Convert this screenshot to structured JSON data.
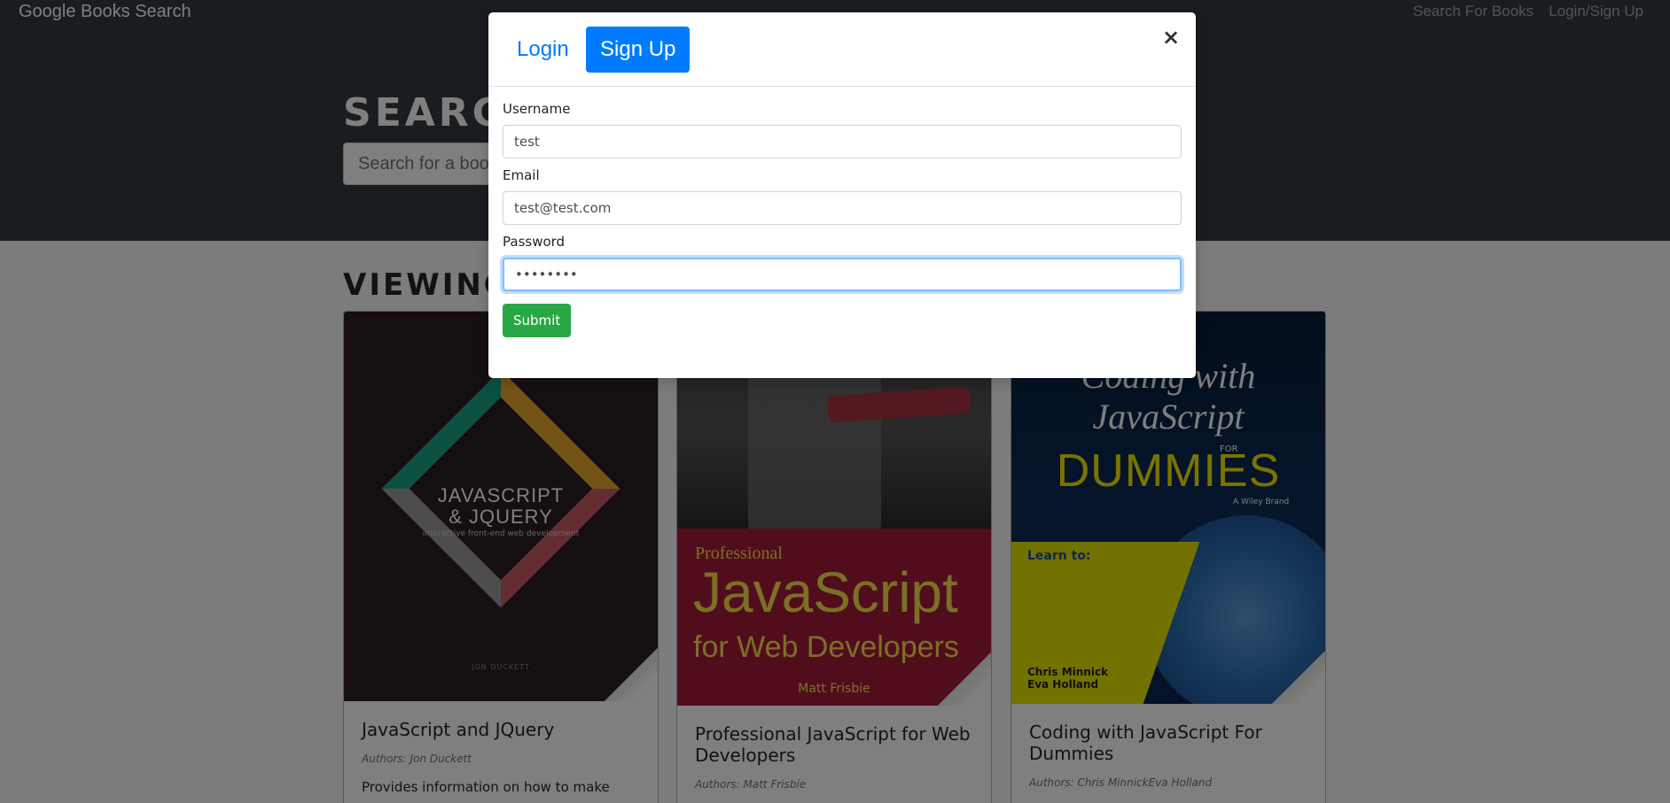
{
  "navbar": {
    "brand": "Google Books Search",
    "links": [
      "Search For Books",
      "Login/Sign Up"
    ]
  },
  "hero": {
    "title": "SEARCH FOR BOOKS!",
    "search_placeholder": "Search for a book"
  },
  "results": {
    "title": "VIEWING 3 RESULTS:",
    "cards": [
      {
        "cover": {
          "title_line1": "JAVASCRIPT",
          "title_line2": "& JQUERY",
          "subtitle": "interactive front-end web development",
          "publisher": "JON DUCKETT"
        },
        "title": "JavaScript and JQuery",
        "authors": "Authors: Jon Duckett",
        "description": "Provides information on how to make"
      },
      {
        "cover": {
          "kicker": "Professional",
          "title_line1": "JavaScript",
          "title_line2": "for Web Developers",
          "author": "Matt Frisbie"
        },
        "title": "Professional JavaScript for Web Developers",
        "authors": "Authors: Matt Frisbie",
        "description": ""
      },
      {
        "cover": {
          "title_line1": "Coding with",
          "title_line2": "JavaScript",
          "for": "FOR",
          "brand": "DUMMIES",
          "publisher": "A Wiley Brand",
          "learn_heading": "Learn to:",
          "authors_line1": "Chris Minnick",
          "authors_line2": "Eva Holland"
        },
        "title": "Coding with JavaScript For Dummies",
        "authors": "Authors: Chris MinnickEva Holland",
        "description": ""
      }
    ]
  },
  "modal": {
    "tabs": {
      "login": "Login",
      "signup": "Sign Up"
    },
    "active_tab": "signup",
    "close_glyph": "×",
    "fields": {
      "username": {
        "label": "Username",
        "value": "test"
      },
      "email": {
        "label": "Email",
        "value": "test@test.com"
      },
      "password": {
        "label": "Password",
        "value": "password"
      }
    },
    "submit_label": "Submit"
  },
  "colors": {
    "navbar_bg": "#343a40",
    "primary": "#007bff",
    "success": "#28a745",
    "backdrop": "rgba(0,0,0,0.5)"
  }
}
